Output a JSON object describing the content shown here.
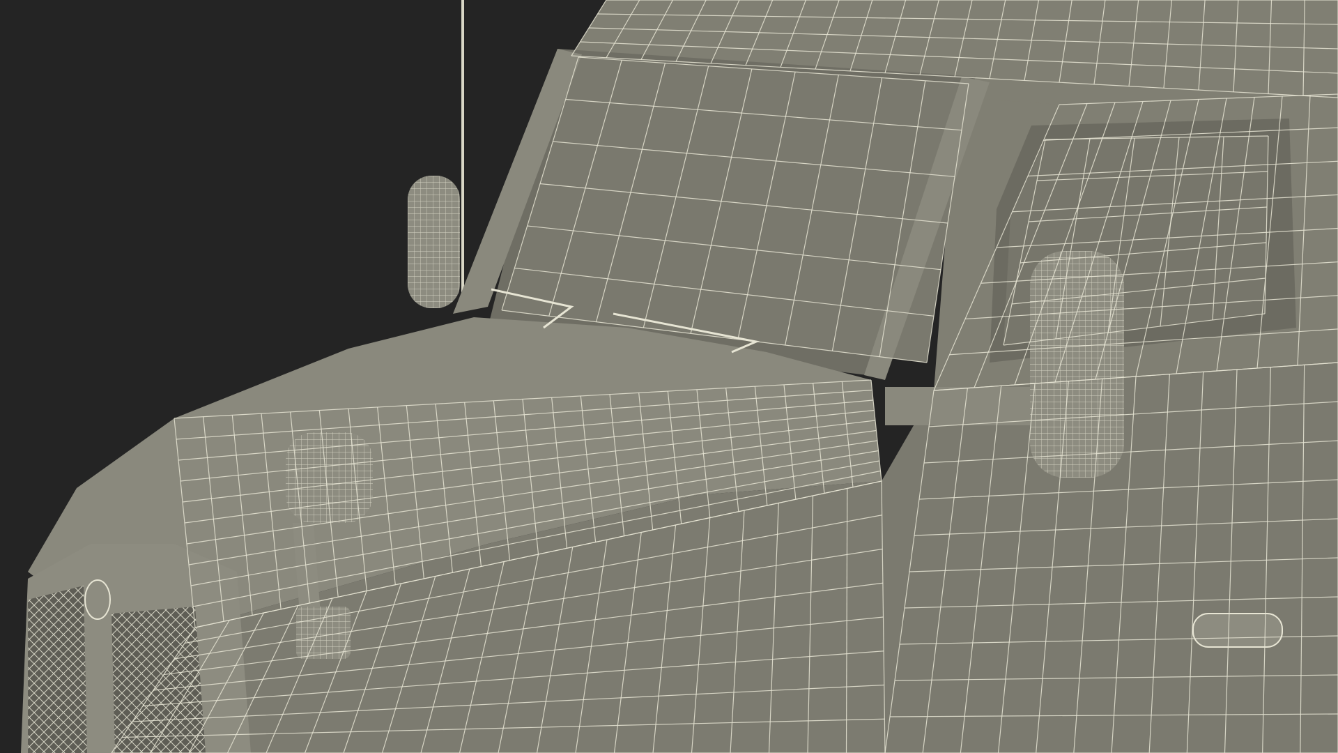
{
  "scene": {
    "subject": "truck-cab-wireframe",
    "render_mode": "wireframe-on-shaded",
    "colors": {
      "background": "#242424",
      "body": "#807f73",
      "body_dark": "#6c6b61",
      "body_light": "#8d8c80",
      "glass": "#7a796e",
      "grille": "#5e5d55",
      "wire": "#e7e5d4",
      "wire_faint": "#c9c7b6"
    }
  }
}
